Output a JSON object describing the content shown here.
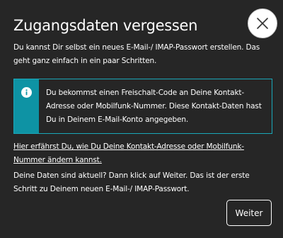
{
  "dialog": {
    "title": "Zugangsdaten vergessen",
    "close_icon": "close-icon",
    "intro": "Du kannst Dir selbst ein neues E-Mail-/ IMAP-Passwort erstellen. Das geht ganz einfach in ein paar Schritten.",
    "info": {
      "icon": "info-icon",
      "text": "Du bekommst einen Freischalt-Code an Deine Kontakt-Adresse oder Mobilfunk-Nummer. Diese Kontakt-Daten hast Du in Deinem E-Mail-Konto angegeben."
    },
    "help_link": "Hier erfährst Du, wie Du Deine Kontakt-Adresse oder Mobilfunk-Nummer ändern kannst.",
    "outro": "Deine Daten sind aktuell? Dann klick auf Weiter. Das ist der erste Schritt zu Deinem neuen E-Mail-/ IMAP-Passwort.",
    "next_label": "Weiter"
  },
  "colors": {
    "background": "#262626",
    "text": "#ffffff",
    "info_accent": "#0e93a4",
    "info_border": "#1aa7b8"
  }
}
